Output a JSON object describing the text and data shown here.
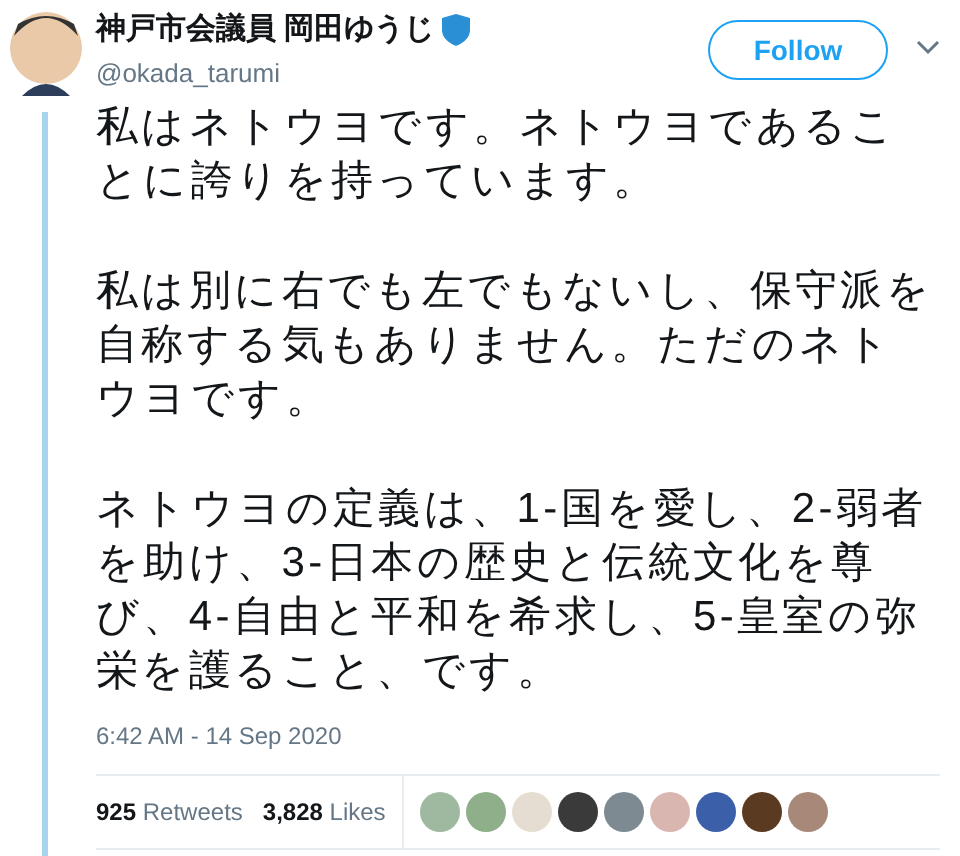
{
  "author": {
    "name": "神戸市会議員 岡田ゆうじ",
    "handle": "@okada_tarumi"
  },
  "follow_button": "Follow",
  "paragraphs": [
    "私はネトウヨです。ネトウヨであることに誇りを持っています。",
    "私は別に右でも左でもないし、保守派を自称する気もありません。ただのネトウヨです。",
    "ネトウヨの定義は、1-国を愛し、2-弱者を助け、3-日本の歴史と伝統文化を尊び、4-自由と平和を希求し、5-皇室の弥栄を護ること、です。"
  ],
  "timestamp": "6:42 AM - 14 Sep 2020",
  "stats": [
    {
      "count": "925",
      "label": "Retweets"
    },
    {
      "count": "3,828",
      "label": "Likes"
    }
  ],
  "liker_avatars": [
    {
      "color": "#9fb8a0"
    },
    {
      "color": "#8fae8a"
    },
    {
      "color": "#e6ddd2"
    },
    {
      "color": "#3a3a3a"
    },
    {
      "color": "#7d8a91"
    },
    {
      "color": "#d9b7b0"
    },
    {
      "color": "#3b5fa8"
    },
    {
      "color": "#5a3a20"
    },
    {
      "color": "#a88878"
    }
  ]
}
